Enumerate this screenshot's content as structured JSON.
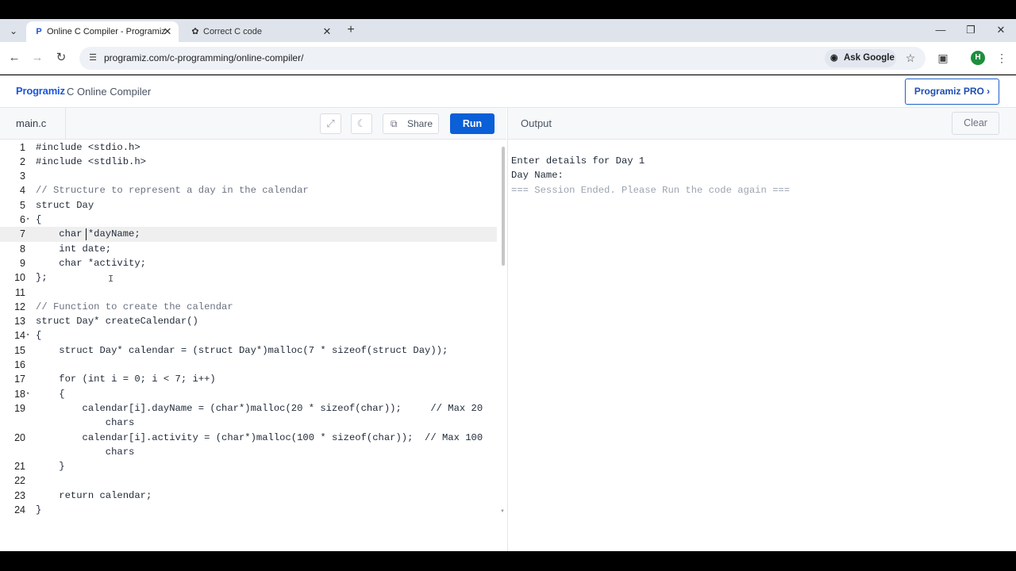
{
  "browser": {
    "tabs": [
      {
        "title": "Online C Compiler - Programiz",
        "favicon": "programiz-favicon",
        "active": true
      },
      {
        "title": "Correct C code",
        "favicon": "chatgpt-favicon",
        "active": false
      }
    ],
    "url": "programiz.com/c-programming/online-compiler/",
    "ask_google": "Ask Google",
    "profile_initial": "H"
  },
  "site": {
    "logo_text": "Programiz",
    "title": "C Online Compiler",
    "pro_button": "Programiz PRO ›"
  },
  "editor": {
    "file_name": "main.c",
    "share_label": "Share",
    "run_label": "Run"
  },
  "output": {
    "title": "Output",
    "clear_label": "Clear",
    "lines": [
      "Enter details for Day 1",
      "Day Name:",
      "=== Session Ended. Please Run the code again ==="
    ]
  },
  "code": {
    "line_numbers": [
      "1",
      "2",
      "3",
      "4",
      "5",
      "6",
      "7",
      "8",
      "9",
      "10",
      "11",
      "12",
      "13",
      "14",
      "15",
      "16",
      "17",
      "18",
      "19",
      "",
      "20",
      "",
      "21",
      "22",
      "23",
      "24"
    ],
    "lines": [
      "#include <stdio.h>",
      "#include <stdlib.h>",
      "",
      "// Structure to represent a day in the calendar",
      "struct Day",
      "{",
      "    char *dayName;",
      "    int date;",
      "    char *activity;",
      "};",
      "",
      "// Function to create the calendar",
      "struct Day* createCalendar()",
      "{",
      "    struct Day* calendar = (struct Day*)malloc(7 * sizeof(struct Day));",
      "",
      "    for (int i = 0; i < 7; i++)",
      "    {",
      "        calendar[i].dayName = (char*)malloc(20 * sizeof(char));     // Max 20",
      "            chars",
      "        calendar[i].activity = (char*)malloc(100 * sizeof(char));  // Max 100",
      "            chars",
      "    }",
      "",
      "    return calendar;",
      "}"
    ],
    "current_line_index": 6,
    "fold_markers": [
      5,
      13,
      17
    ]
  },
  "colors": {
    "run_button": "#0b5fd7",
    "accent": "#1e62c8"
  }
}
